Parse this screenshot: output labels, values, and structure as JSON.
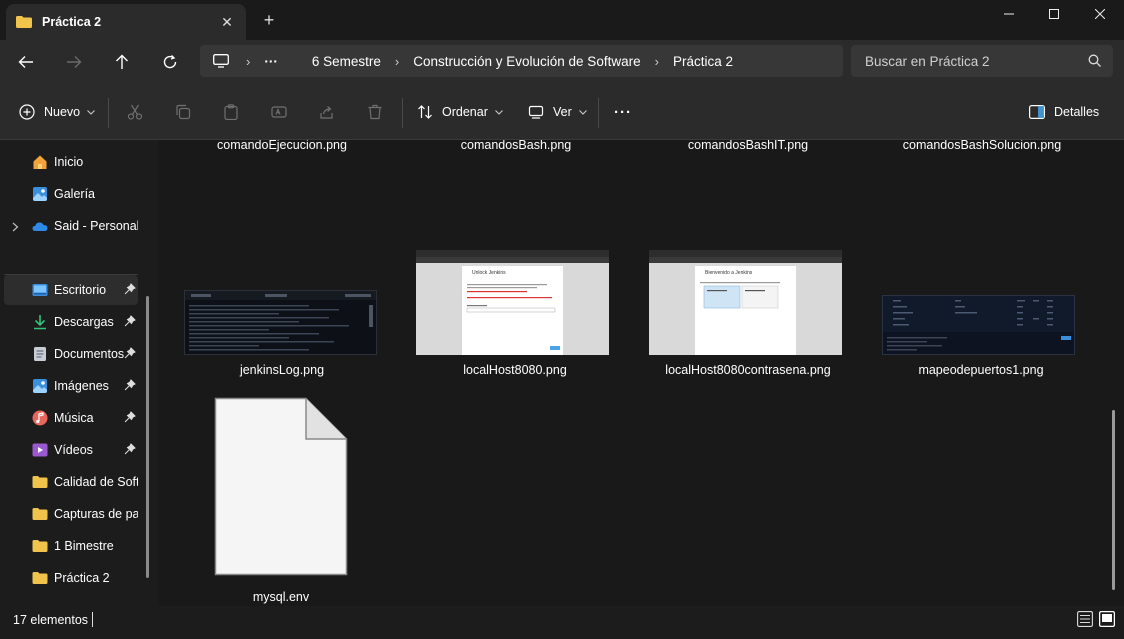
{
  "window": {
    "tab_title": "Práctica 2",
    "new_tab_symbol": "+",
    "close_tab_symbol": "✕"
  },
  "breadcrumb": {
    "overflow": "···",
    "segments": [
      "6 Semestre",
      "Construcción y Evolución de Software",
      "Práctica 2"
    ]
  },
  "search": {
    "placeholder": "Buscar en Práctica 2"
  },
  "toolbar": {
    "new_label": "Nuevo",
    "sort_label": "Ordenar",
    "view_label": "Ver",
    "more_symbol": "···",
    "details_label": "Detalles"
  },
  "sidebar": {
    "items": [
      {
        "label": "Inicio",
        "icon": "home-icon"
      },
      {
        "label": "Galería",
        "icon": "gallery-icon"
      },
      {
        "label": "Said - Personal",
        "icon": "onedrive-icon"
      },
      {
        "label": "Escritorio",
        "icon": "desktop-icon",
        "pinned": true,
        "selected": true
      },
      {
        "label": "Descargas",
        "icon": "download-icon",
        "pinned": true
      },
      {
        "label": "Documentos",
        "icon": "documents-icon",
        "pinned": true
      },
      {
        "label": "Imágenes",
        "icon": "pictures-icon",
        "pinned": true
      },
      {
        "label": "Música",
        "icon": "music-icon",
        "pinned": true
      },
      {
        "label": "Vídeos",
        "icon": "videos-icon",
        "pinned": true
      },
      {
        "label": "Calidad de Softw",
        "icon": "folder-icon"
      },
      {
        "label": "Capturas de par",
        "icon": "folder-icon"
      },
      {
        "label": "1 Bimestre",
        "icon": "folder-icon"
      },
      {
        "label": "Práctica 2",
        "icon": "folder-icon"
      }
    ]
  },
  "files": [
    {
      "name": "comandoEjecucion.png"
    },
    {
      "name": "comandosBash.png"
    },
    {
      "name": "comandosBashIT.png"
    },
    {
      "name": "comandosBashSolucion.png"
    },
    {
      "name": "jenkinsLog.png",
      "thumbnail": "terminal-log"
    },
    {
      "name": "localHost8080.png",
      "thumbnail": "browser-page"
    },
    {
      "name": "localHost8080contrasena.png",
      "thumbnail": "browser-welcome"
    },
    {
      "name": "mapeodepuertos1.png",
      "thumbnail": "terminal-table"
    },
    {
      "name": "mysql.env",
      "thumbnail": "generic-file"
    }
  ],
  "thumb_text": {
    "unlock": "Unlock Jenkins",
    "welcome": "Bienvenido a Jenkins"
  },
  "status": {
    "item_count": "17 elementos"
  },
  "colors": {
    "folder": "#f0c34a",
    "accent_blue": "#4aa3e8",
    "window_bg": "#1c1c1c"
  }
}
